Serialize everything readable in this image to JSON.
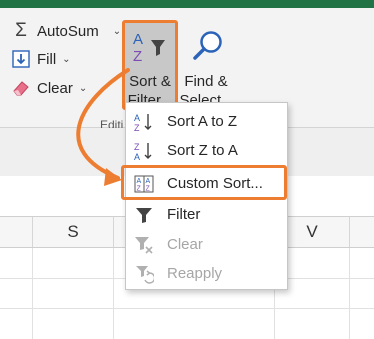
{
  "ribbon": {
    "autosum_label": "AutoSum",
    "fill_label": "Fill",
    "clear_label": "Clear",
    "sort_filter_line1": "Sort &",
    "sort_filter_line2": "Filter",
    "find_select_line1": "Find &",
    "find_select_line2": "Select",
    "group_label_partial": "Editi"
  },
  "menu": {
    "items": [
      {
        "label": "Sort A to Z",
        "icon": "sort-a-to-z-icon",
        "enabled": true
      },
      {
        "label": "Sort Z to A",
        "icon": "sort-z-to-a-icon",
        "enabled": true
      },
      {
        "label": "Custom Sort...",
        "icon": "custom-sort-icon",
        "enabled": true
      },
      {
        "label": "Filter",
        "icon": "filter-icon",
        "enabled": true
      },
      {
        "label": "Clear",
        "icon": "clear-filter-icon",
        "enabled": false
      },
      {
        "label": "Reapply",
        "icon": "reapply-icon",
        "enabled": false
      }
    ]
  },
  "columns": {
    "headers": [
      "S",
      "V"
    ]
  },
  "colors": {
    "excel_green": "#217346",
    "highlight_orange": "#ed7d31",
    "az_blue": "#2b63b8",
    "z_purple": "#7c4bb3"
  }
}
